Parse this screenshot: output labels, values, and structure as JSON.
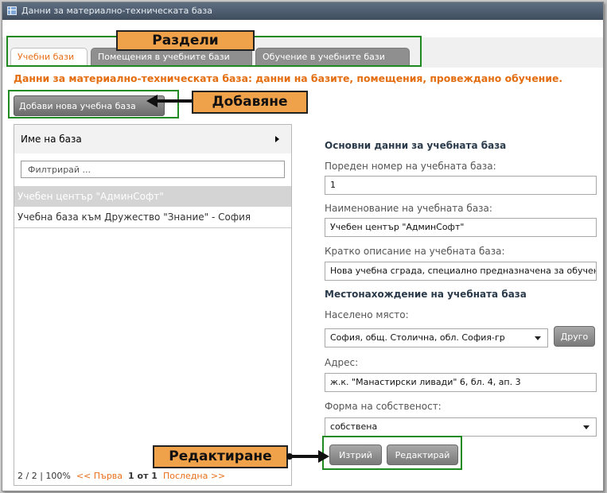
{
  "window": {
    "title": "Данни за материално-техническата база",
    "icon": "table-icon"
  },
  "tabs": [
    {
      "label": "Учебни бази",
      "active": true
    },
    {
      "label": "Помещения в учебните бази",
      "active": false
    },
    {
      "label": "Обучение в учебните бази",
      "active": false
    }
  ],
  "heading": "Данни за материално-техническата база: данни на базите, помещения, провеждано обучение.",
  "toolbar": {
    "add_label": "Добави нова учебна база"
  },
  "list": {
    "header": "Име на база",
    "filter_placeholder": "Филтрирай ...",
    "items": [
      "Учебен център \"АдминСофт\"",
      "Учебна база към Дружество \"Знание\" - София"
    ],
    "pager": {
      "summary": "2 / 2 | 100%",
      "first": "<< Първа",
      "page_info": "1 от 1",
      "last": "Последна >>"
    }
  },
  "form": {
    "section_basic": "Основни данни за учебната база",
    "number_label": "Пореден номер на учебната база:",
    "number_value": "1",
    "name_label": "Наименование на учебната база:",
    "name_value": "Учебен център \"АдминСофт\"",
    "desc_label": "Кратко описание на учебната база:",
    "desc_value": "Нова учебна сграда, специално предназначена за обучение",
    "section_location": "Местонахождение на учебната база",
    "place_label": "Населено място:",
    "place_value": "София, общ. Столична, обл. София-гр",
    "other_label": "Друго",
    "address_label": "Адрес:",
    "address_value": "ж.к. \"Манастирски ливади\" 6, бл. 4, ап. 3",
    "ownership_label": "Форма на собственост:",
    "ownership_value": "собствена",
    "delete_label": "Изтрий",
    "edit_label": "Редактирай"
  },
  "annotations": {
    "sections": "Раздели",
    "add": "Добавяне",
    "edit": "Редактиране"
  },
  "colors": {
    "accent": "#e8701a",
    "highlight_box": "#1f8a1f",
    "callout": "#f0a24b"
  }
}
